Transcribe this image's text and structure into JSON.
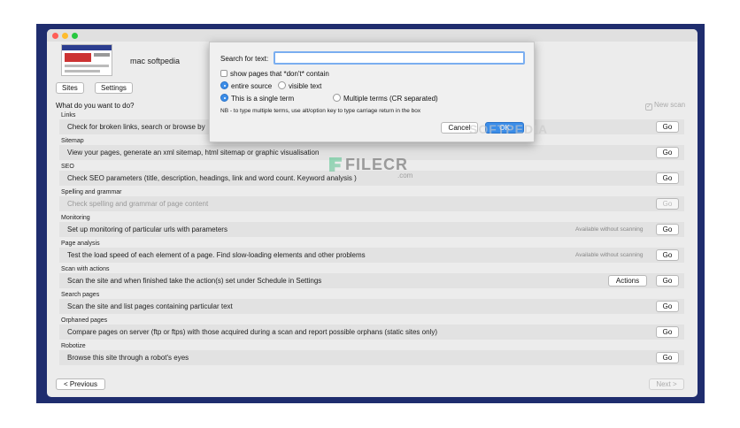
{
  "header": {
    "site_name": "mac softpedia"
  },
  "tabs": {
    "sites": "Sites",
    "settings": "Settings"
  },
  "question": "What do you want to do?",
  "new_scan": {
    "label": "New scan",
    "check": "✓"
  },
  "sections": [
    {
      "title": "Links",
      "text": "Check for broken links, search or browse by",
      "note": "",
      "go": "Go"
    },
    {
      "title": "Sitemap",
      "text": "View your pages, generate an xml sitemap, html sitemap or graphic visualisation",
      "note": "",
      "go": "Go"
    },
    {
      "title": "SEO",
      "text": "Check SEO parameters (title, description, headings, link and word count. Keyword analysis )",
      "note": "",
      "go": "Go"
    },
    {
      "title": "Spelling and grammar",
      "text": "Check spelling and grammar of page content",
      "note": "",
      "go": "Go"
    },
    {
      "title": "Monitoring",
      "text": "Set up monitoring of particular urls with parameters",
      "note": "Available without scanning",
      "go": "Go"
    },
    {
      "title": "Page analysis",
      "text": "Test the load speed of each element of a page. Find slow-loading elements and other problems",
      "note": "Available without scanning",
      "go": "Go"
    },
    {
      "title": "Scan with actions",
      "text": "Scan the site and when finished take the action(s) set under Schedule in Settings",
      "note": "",
      "actions": "Actions",
      "go": "Go"
    },
    {
      "title": "Search pages",
      "text": "Scan the site and list pages containing particular text",
      "note": "",
      "go": "Go"
    },
    {
      "title": "Orphaned pages",
      "text": "Compare pages on server (ftp or ftps) with those acquired during a scan and report possible orphans (static sites only)",
      "note": "",
      "go": "Go"
    },
    {
      "title": "Robotize",
      "text": "Browse this site through a robot's eyes",
      "note": "",
      "go": "Go"
    }
  ],
  "footer": {
    "previous": "< Previous",
    "next": "Next >"
  },
  "dialog": {
    "label": "Search for text:",
    "input_value": "",
    "show_pages_not": "show pages that *don't* contain",
    "entire_source": "entire source",
    "visible_text": "visible text",
    "single_term": "This is a single term",
    "multiple_terms": "Multiple terms (CR separated)",
    "note": "NB - to type multiple terms, use alt/option key to type carriage return in the box",
    "cancel": "Cancel",
    "ok": "OK"
  },
  "watermarks": {
    "filecr": "FILECR",
    "filecr_com": ".com",
    "softpedia": "SOFTPEDIA"
  },
  "colors": {
    "frame": "#1f2d6e",
    "accent": "#3b8de8",
    "window": "#ececec"
  }
}
